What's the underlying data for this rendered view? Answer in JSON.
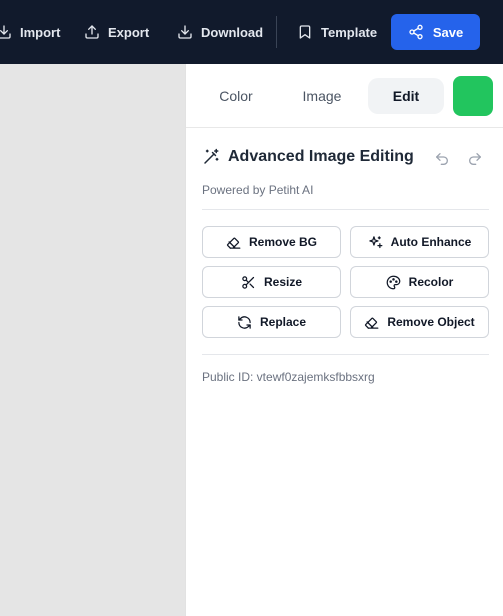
{
  "toolbar": {
    "import_label": "Import",
    "export_label": "Export",
    "download_label": "Download",
    "template_label": "Template",
    "save_label": "Save",
    "save_color": "#2563eb",
    "background": "#111a2c"
  },
  "tabs": {
    "color_label": "Color",
    "image_label": "Image",
    "edit_label": "Edit",
    "active": "Edit",
    "swatch_color": "#22c55e"
  },
  "editing": {
    "title": "Advanced Image Editing",
    "powered_by": "Powered by Petiht AI",
    "tools": {
      "remove_bg": "Remove BG",
      "auto_enhance": "Auto Enhance",
      "resize": "Resize",
      "recolor": "Recolor",
      "replace": "Replace",
      "remove_object": "Remove Object"
    },
    "public_id": "Public ID: vtewf0zajemksfbbsxrg"
  }
}
